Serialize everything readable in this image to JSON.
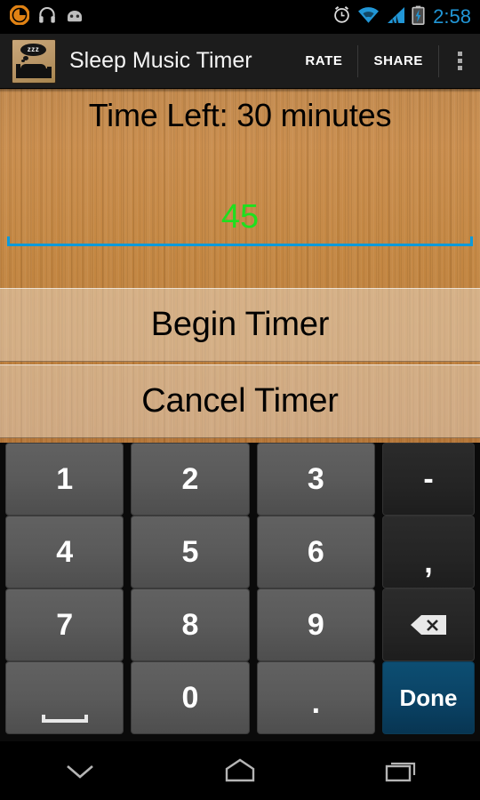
{
  "status_bar": {
    "time": "2:58",
    "left_icons": [
      {
        "name": "music-app-icon",
        "glyph": "circular-orange-swirl"
      },
      {
        "name": "headphones-icon",
        "glyph": "headphones"
      },
      {
        "name": "android-head-icon",
        "glyph": "android-robot-head"
      }
    ],
    "right_icons": [
      {
        "name": "alarm-clock-icon",
        "glyph": "alarm"
      },
      {
        "name": "wifi-icon",
        "glyph": "wifi-full"
      },
      {
        "name": "cellular-signal-icon",
        "glyph": "signal-4-bars"
      },
      {
        "name": "battery-charging-icon",
        "glyph": "battery-bolt"
      }
    ],
    "clock_color": "#2196d6"
  },
  "action_bar": {
    "app_icon_name": "sleep-music-timer-app-icon",
    "app_icon_zzz": "zzz",
    "title": "Sleep Music Timer",
    "rate_label": "RATE",
    "share_label": "SHARE",
    "overflow_label": "More options",
    "background": "#1c1c1c"
  },
  "main": {
    "time_left_text": "Time Left: 30 minutes",
    "minutes_input": {
      "value": "45",
      "placeholder": "",
      "text_color": "#1ee01e",
      "underline_color": "#0c9ada"
    },
    "begin_button_label": "Begin Timer",
    "cancel_button_label": "Cancel Timer",
    "background": "wood-grain"
  },
  "keyboard": {
    "rows": [
      [
        {
          "name": "key-1",
          "label": "1",
          "type": "num"
        },
        {
          "name": "key-2",
          "label": "2",
          "type": "num"
        },
        {
          "name": "key-3",
          "label": "3",
          "type": "num"
        },
        {
          "name": "key-dash",
          "label": "-",
          "type": "fn"
        }
      ],
      [
        {
          "name": "key-4",
          "label": "4",
          "type": "num"
        },
        {
          "name": "key-5",
          "label": "5",
          "type": "num"
        },
        {
          "name": "key-6",
          "label": "6",
          "type": "num"
        },
        {
          "name": "key-comma",
          "label": ",",
          "type": "fn"
        }
      ],
      [
        {
          "name": "key-7",
          "label": "7",
          "type": "num"
        },
        {
          "name": "key-8",
          "label": "8",
          "type": "num"
        },
        {
          "name": "key-9",
          "label": "9",
          "type": "num"
        },
        {
          "name": "key-backspace",
          "label": "",
          "type": "backspace"
        }
      ],
      [
        {
          "name": "key-space",
          "label": "",
          "type": "space"
        },
        {
          "name": "key-0",
          "label": "0",
          "type": "num"
        },
        {
          "name": "key-period",
          "label": ".",
          "type": "num"
        },
        {
          "name": "key-done",
          "label": "Done",
          "type": "done"
        }
      ]
    ],
    "key_color": "#5a5a5a",
    "fn_key_color": "#242424",
    "done_key_color": "#0a4163"
  },
  "nav_bar": {
    "buttons": [
      {
        "name": "nav-hide-keyboard-button",
        "glyph": "chevron-down"
      },
      {
        "name": "nav-home-button",
        "glyph": "home-pentagon"
      },
      {
        "name": "nav-recents-button",
        "glyph": "recents-squares"
      }
    ]
  }
}
